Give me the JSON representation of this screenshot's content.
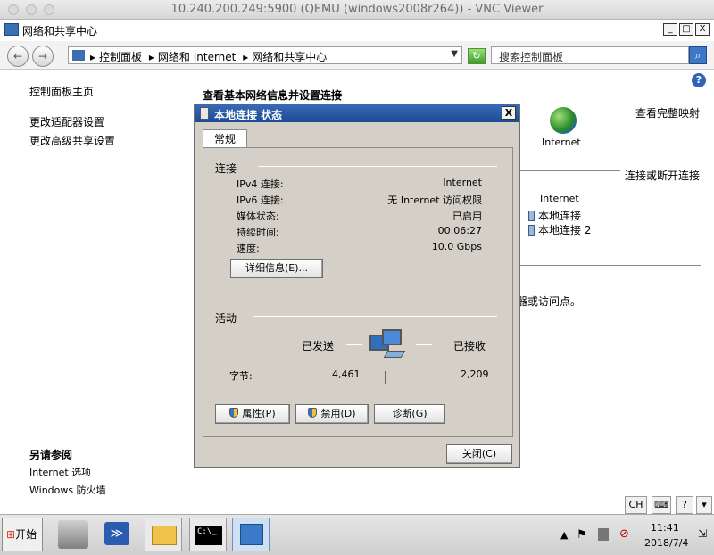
{
  "vnc": {
    "title": "10.240.200.249:5900 (QEMU (windows2008r264)) - VNC Viewer"
  },
  "window": {
    "title": "网络和共享中心",
    "minimize": "_",
    "maximize": "□",
    "close": "X"
  },
  "nav": {
    "back": "←",
    "forward": "→",
    "breadcrumb": [
      "控制面板",
      "网络和 Internet",
      "网络和共享中心"
    ],
    "search_placeholder": "搜索控制面板",
    "refresh": "↻"
  },
  "sidebar": {
    "links": [
      "控制面板主页",
      "更改适配器设置",
      "更改高级共享设置"
    ],
    "see_also_title": "另请参阅",
    "see_also": [
      "Internet 选项",
      "Windows 防火墙"
    ]
  },
  "main": {
    "heading": "查看基本网络信息并设置连接",
    "view_full_map": "查看完整映射",
    "internet_label": "Internet",
    "connect_disconnect": "连接或断开连接",
    "access_type": "Internet",
    "connections": [
      "本地连接",
      "本地连接 2"
    ],
    "partial_text": "器或访问点。"
  },
  "dialog": {
    "title": "本地连接 状态",
    "close": "X",
    "tab": "常规",
    "connection_section": "连接",
    "rows": [
      {
        "label": "IPv4 连接:",
        "value": "Internet"
      },
      {
        "label": "IPv6 连接:",
        "value": "无 Internet 访问权限"
      },
      {
        "label": "媒体状态:",
        "value": "已启用"
      },
      {
        "label": "持续时间:",
        "value": "00:06:27"
      },
      {
        "label": "速度:",
        "value": "10.0 Gbps"
      }
    ],
    "details_button": "详细信息(E)...",
    "activity_section": "活动",
    "sent_label": "已发送",
    "received_label": "已接收",
    "bytes_label": "字节:",
    "bytes_sent": "4,461",
    "bytes_received": "2,209",
    "properties_button": "属性(P)",
    "disable_button": "禁用(D)",
    "diagnose_button": "诊断(G)",
    "close_button": "关闭(C)"
  },
  "taskbar": {
    "start": "开始",
    "clock_time": "11:41",
    "clock_date": "2018/7/4",
    "lang": "CH"
  }
}
